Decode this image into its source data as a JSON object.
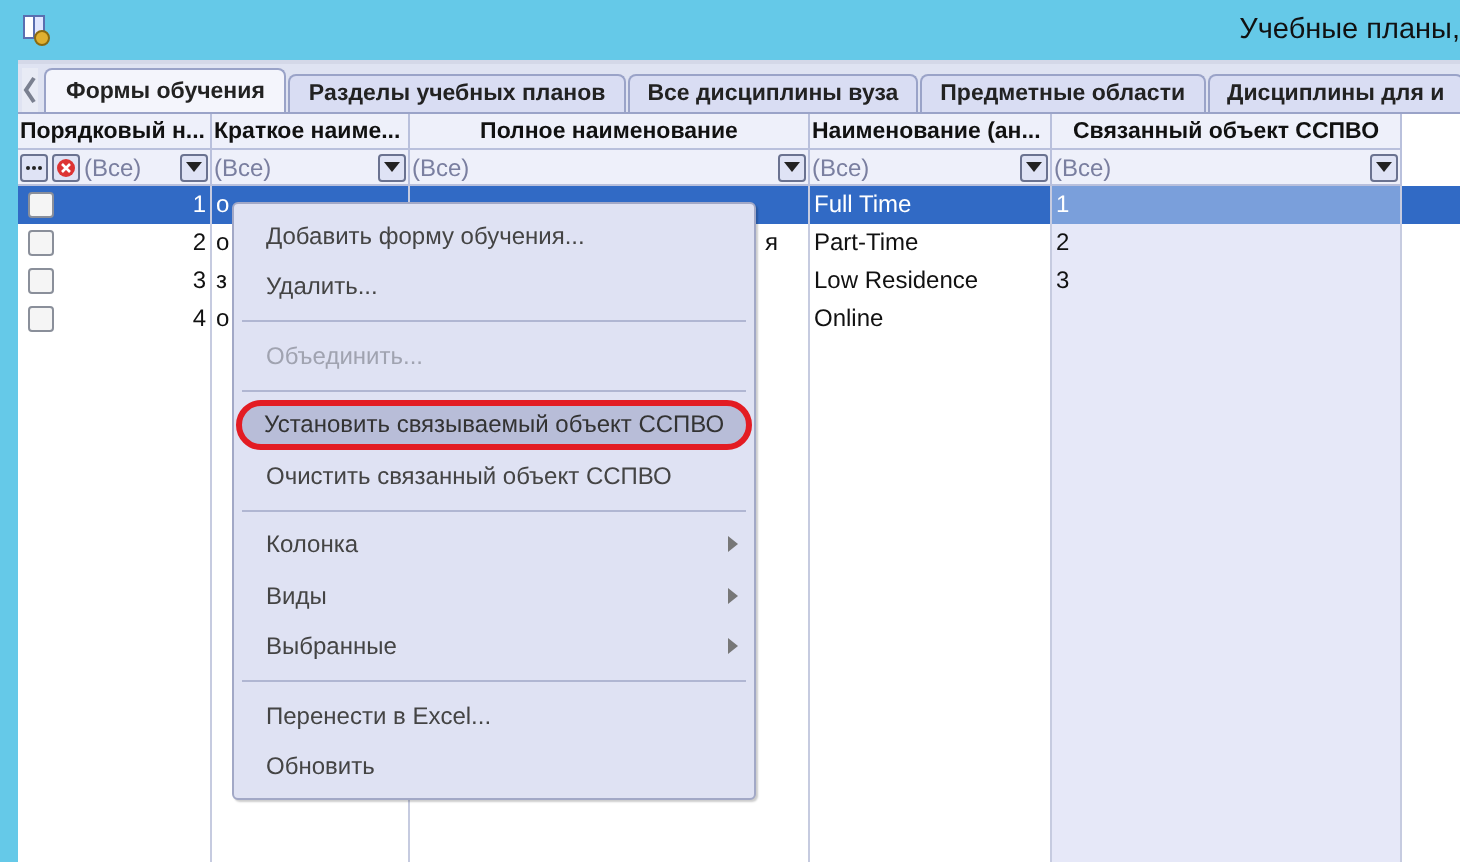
{
  "window": {
    "title": "Учебные планы,"
  },
  "tabs": [
    {
      "label": "Формы обучения",
      "selected": true
    },
    {
      "label": "Разделы учебных планов",
      "selected": false
    },
    {
      "label": "Все дисциплины вуза",
      "selected": false
    },
    {
      "label": "Предметные области",
      "selected": false
    },
    {
      "label": "Дисциплины для и",
      "selected": false
    }
  ],
  "table": {
    "columns": [
      "Порядковый н...",
      "Краткое наиме...",
      "Полное наименование",
      "Наименование (ан...",
      "Связанный объект ССПВО"
    ],
    "filters": [
      "(Все)",
      "(Все)",
      "(Все)",
      "(Все)",
      "(Все)"
    ],
    "rows": [
      {
        "checked": false,
        "selected": true,
        "cells": [
          "1",
          "о",
          "",
          "Full Time",
          "1"
        ]
      },
      {
        "checked": false,
        "selected": false,
        "cells": [
          "2",
          "о",
          "я",
          "Part-Time",
          "2"
        ]
      },
      {
        "checked": false,
        "selected": false,
        "cells": [
          "3",
          "з",
          "",
          "Low Residence",
          "3"
        ]
      },
      {
        "checked": false,
        "selected": false,
        "cells": [
          "4",
          "о",
          "",
          "Online",
          ""
        ]
      }
    ]
  },
  "context_menu": {
    "groups": [
      [
        {
          "label": "Добавить форму обучения...",
          "disabled": false,
          "highlighted": false,
          "submenu": false
        },
        {
          "label": "Удалить...",
          "disabled": false,
          "highlighted": false,
          "submenu": false
        }
      ],
      [
        {
          "label": "Объединить...",
          "disabled": true,
          "highlighted": false,
          "submenu": false
        }
      ],
      [
        {
          "label": "Установить связываемый объект ССПВО",
          "disabled": false,
          "highlighted": true,
          "submenu": false
        },
        {
          "label": "Очистить связанный объект ССПВО",
          "disabled": false,
          "highlighted": false,
          "submenu": false
        }
      ],
      [
        {
          "label": "Колонка",
          "disabled": false,
          "highlighted": false,
          "submenu": true
        },
        {
          "label": "Виды",
          "disabled": false,
          "highlighted": false,
          "submenu": true
        },
        {
          "label": "Выбранные",
          "disabled": false,
          "highlighted": false,
          "submenu": true
        }
      ],
      [
        {
          "label": "Перенести в Excel...",
          "disabled": false,
          "highlighted": false,
          "submenu": false
        },
        {
          "label": "Обновить",
          "disabled": false,
          "highlighted": false,
          "submenu": false
        }
      ]
    ]
  }
}
